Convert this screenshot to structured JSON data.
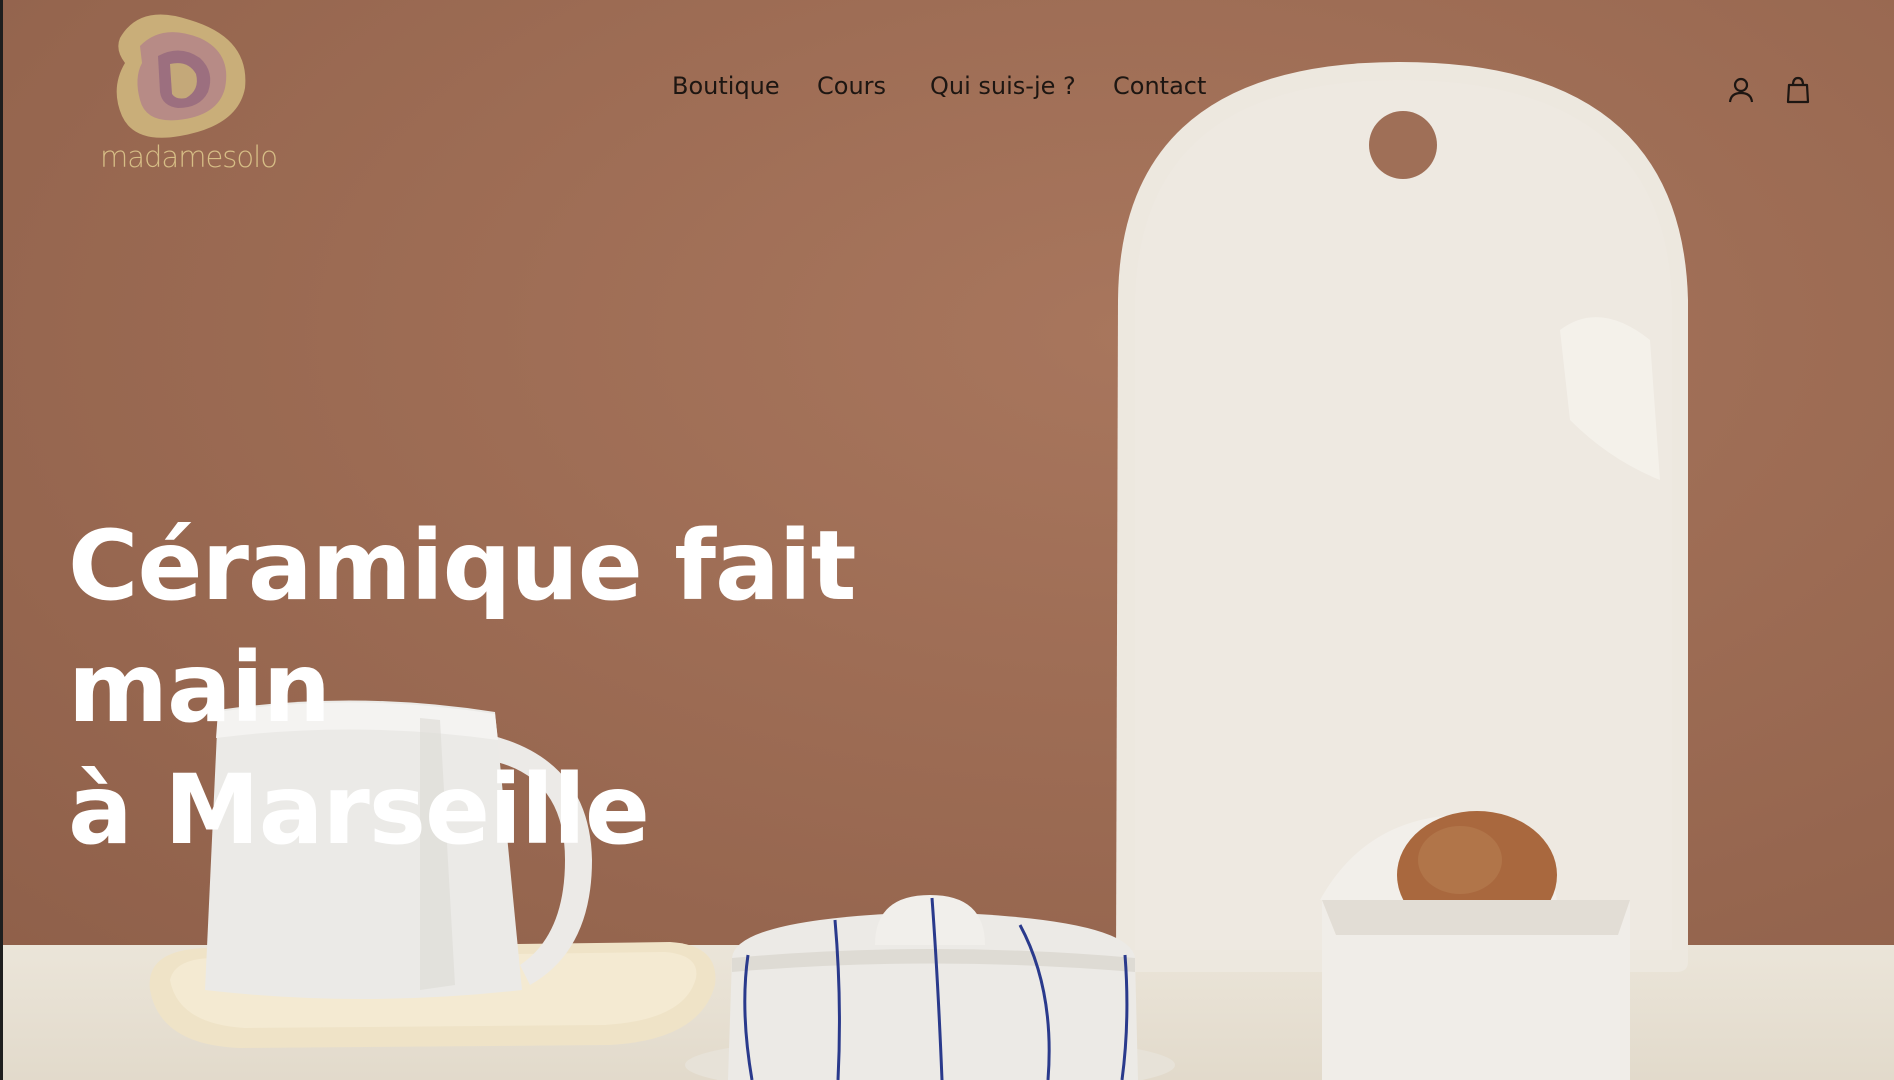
{
  "brand": {
    "name": "madamesolo",
    "colors": {
      "accent": "#d7be86",
      "logo_outer": "#c9ae79",
      "logo_mid": "#b78b86",
      "logo_inner": "#9c6f7f",
      "wall": "#9c6b53"
    }
  },
  "nav": {
    "items": [
      {
        "label": "Boutique"
      },
      {
        "label": "Cours"
      },
      {
        "label": "Qui suis-je ?"
      },
      {
        "label": "Contact"
      }
    ]
  },
  "header_icons": {
    "account": "user-icon",
    "cart": "shopping-bag-icon"
  },
  "hero": {
    "title_line1": "Céramique fait main",
    "title_line2": "à Marseille"
  }
}
